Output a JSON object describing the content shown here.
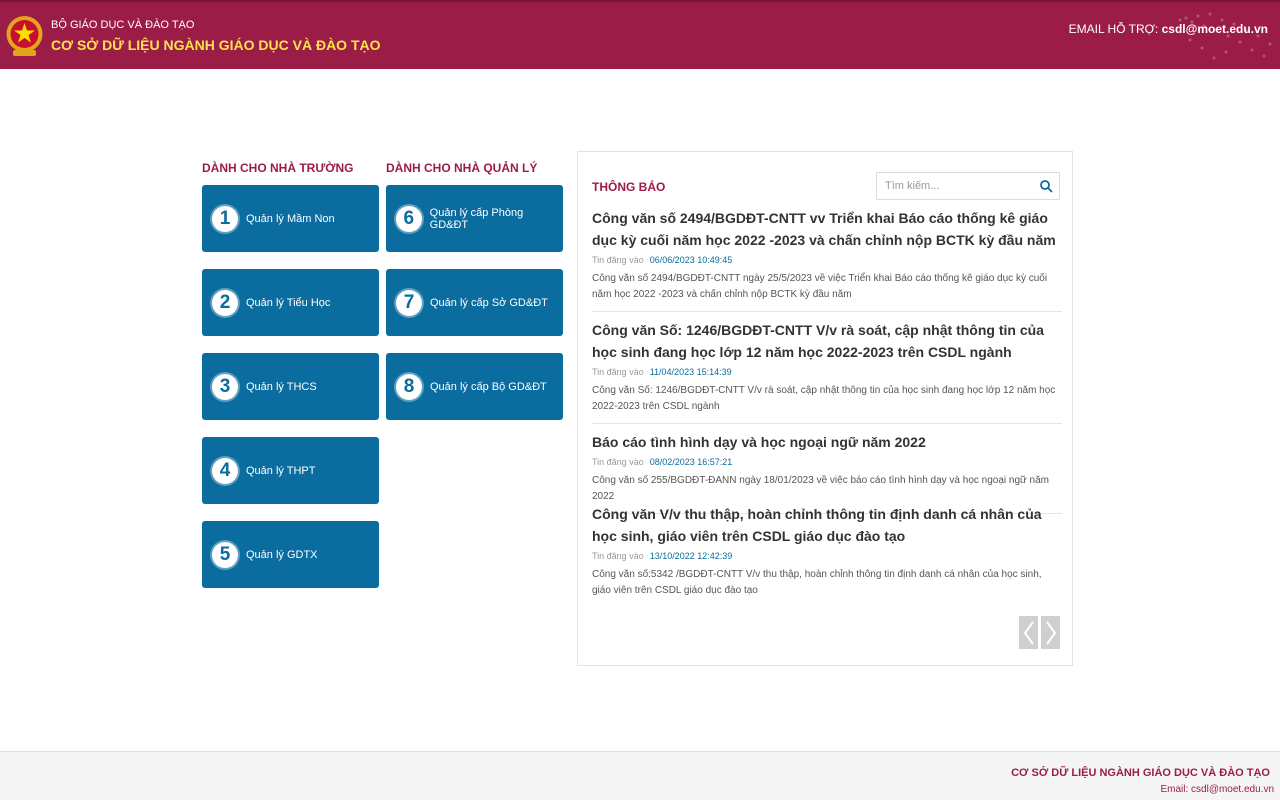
{
  "header": {
    "org_sub": "BỘ GIÁO DỤC VÀ ĐÀO TẠO",
    "org_title": "CƠ SỞ DỮ LIỆU NGÀNH GIÁO DỤC VÀ ĐÀO TẠO",
    "support_label": "EMAIL HỖ TRỢ:",
    "support_email": "csdl@moet.edu.vn"
  },
  "sections": {
    "school_title": "DÀNH CHO NHÀ TRƯỜNG",
    "manager_title": "DÀNH CHO NHÀ QUẢN LÝ"
  },
  "school_tiles": [
    {
      "num": "1",
      "label": "Quản lý Mầm Non"
    },
    {
      "num": "2",
      "label": "Quản lý Tiểu Học"
    },
    {
      "num": "3",
      "label": "Quản lý THCS"
    },
    {
      "num": "4",
      "label": "Quản lý THPT"
    },
    {
      "num": "5",
      "label": "Quản lý GDTX"
    }
  ],
  "manager_tiles": [
    {
      "num": "6",
      "label": "Quản lý cấp Phòng GD&ĐT"
    },
    {
      "num": "7",
      "label": "Quản lý cấp Sở GD&ĐT"
    },
    {
      "num": "8",
      "label": "Quản lý cấp Bộ GD&ĐT"
    }
  ],
  "news": {
    "title": "THÔNG BÁO",
    "search_placeholder": "Tìm kiếm...",
    "posted_label": "Tin đăng vào",
    "items": [
      {
        "title": "Công văn số 2494/BGDĐT-CNTT vv Triển khai Báo cáo thống kê giáo dục kỳ cuối năm học 2022 -2023 và chấn chỉnh nộp BCTK kỳ đầu năm",
        "date": "06/06/2023 10:49:45",
        "desc": "Công văn số 2494/BGDĐT-CNTT ngày 25/5/2023 về việc Triển khai Báo cáo thống kê giáo dục kỳ cuối năm học 2022 -2023 và chấn chỉnh nộp BCTK kỳ đầu năm"
      },
      {
        "title": "Công văn Số: 1246/BGDĐT-CNTT V/v rà soát, cập nhật thông tin của học sinh đang học lớp 12 năm học 2022-2023 trên CSDL ngành",
        "date": "11/04/2023 15:14:39",
        "desc": "Công văn Số: 1246/BGDĐT-CNTT V/v rà soát, cập nhật thông tin của học sinh đang học lớp 12 năm học 2022-2023 trên CSDL ngành"
      },
      {
        "title": "Báo cáo tình hình dạy và học ngoại ngữ năm 2022",
        "date": "08/02/2023 16:57:21",
        "desc": "Công văn số 255/BGDĐT-ĐANN ngày 18/01/2023 về việc báo cáo tình hình dạy và học ngoại ngữ năm 2022"
      },
      {
        "title": "Công văn V/v thu thập, hoàn chỉnh thông tin định danh cá nhân của học sinh, giáo viên trên CSDL giáo dục đào tạo",
        "date": "13/10/2022 12:42:39",
        "desc": "Công văn số:5342 /BGDĐT-CNTT V/v thu thập, hoàn chỉnh thông tin định danh cá nhân của học sinh, giáo viên trên CSDL giáo dục đào tạo"
      }
    ]
  },
  "footer": {
    "title": "CƠ SỞ DỮ LIỆU NGÀNH GIÁO DỤC VÀ ĐÀO TẠO",
    "email_label": "Email:",
    "email": "csdl@moet.edu.vn"
  },
  "icons": {
    "logo": "national-emblem-icon",
    "search": "search-icon",
    "prev": "chevron-left-icon",
    "next": "chevron-right-icon"
  },
  "colors": {
    "brand": "#9c1c48",
    "accent_yellow": "#ffe14d",
    "tile_blue": "#0a6c9f"
  }
}
